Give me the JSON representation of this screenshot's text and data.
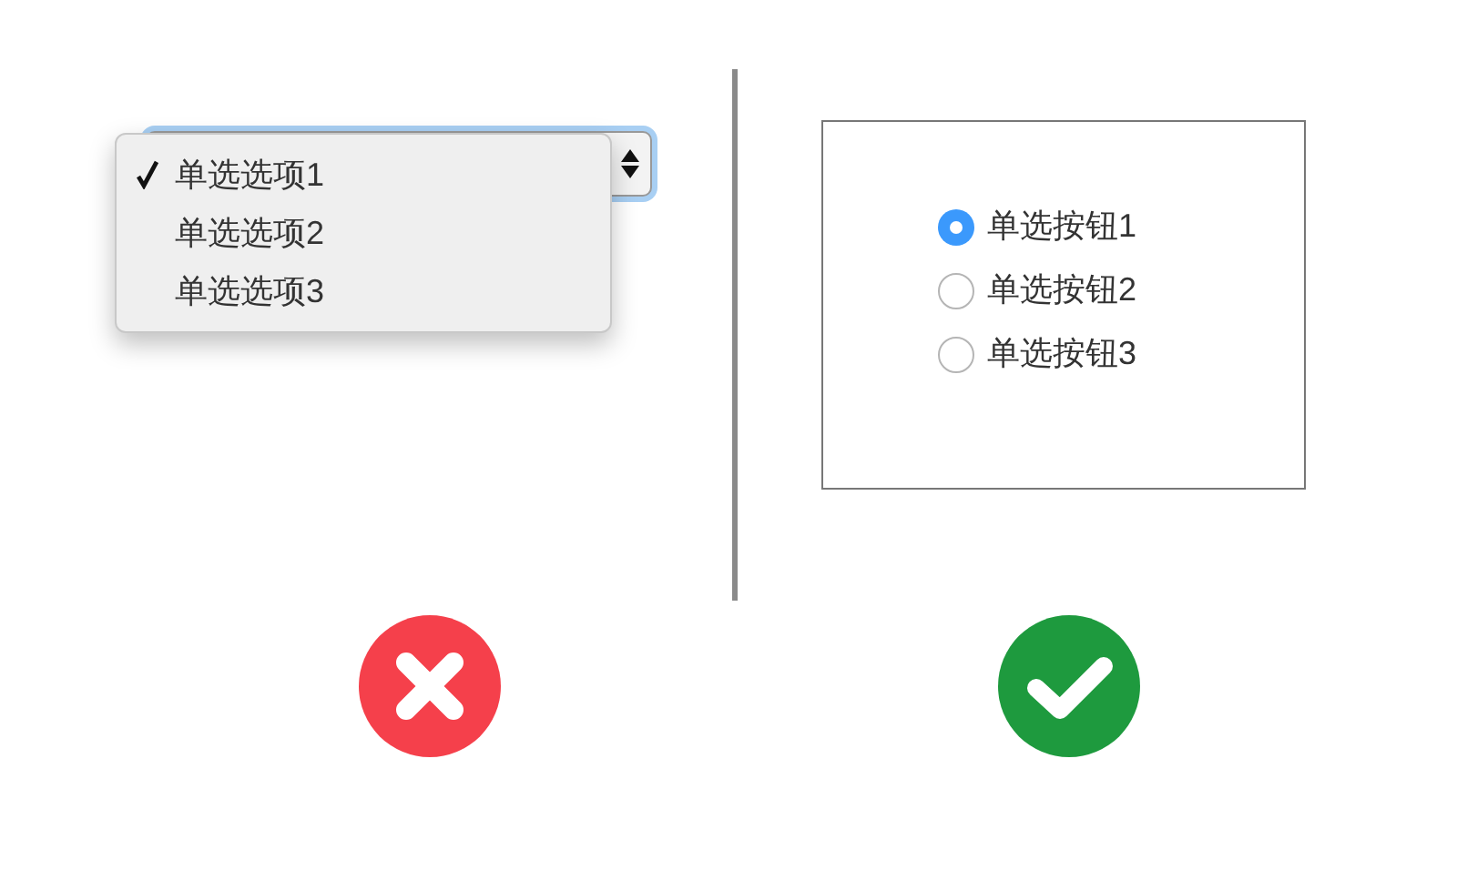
{
  "dropdown": {
    "options": [
      {
        "label": "单选选项1",
        "selected": true
      },
      {
        "label": "单选选项2",
        "selected": false
      },
      {
        "label": "单选选项3",
        "selected": false
      }
    ]
  },
  "radio_group": {
    "options": [
      {
        "label": "单选按钮1",
        "selected": true
      },
      {
        "label": "单选按钮2",
        "selected": false
      },
      {
        "label": "单选按钮3",
        "selected": false
      }
    ]
  },
  "verdicts": [
    {
      "kind": "wrong"
    },
    {
      "kind": "correct"
    }
  ]
}
